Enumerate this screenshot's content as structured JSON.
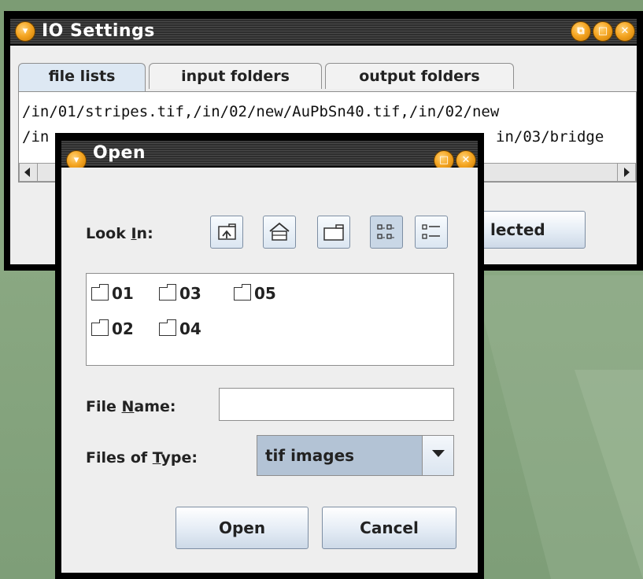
{
  "io_settings": {
    "title": "IO Settings",
    "tabs": [
      {
        "label": "file lists"
      },
      {
        "label": "input folders"
      },
      {
        "label": "output folders"
      }
    ],
    "file_list_lines": [
      "/in/01/stripes.tif,/in/02/new/AuPbSn40.tif,/in/02/new",
      "/in",
      "in/03/bridge"
    ],
    "partial_button_label": "lected"
  },
  "open_dialog": {
    "title": "Open",
    "look_in": {
      "label_pre": "Look ",
      "label_mnemonic": "I",
      "label_post": "n:"
    },
    "toolbar_icons": [
      "up-folder-icon",
      "home-icon",
      "new-folder-icon",
      "list-view-icon",
      "details-view-icon"
    ],
    "folders": [
      "01",
      "03",
      "05",
      "02",
      "04"
    ],
    "file_name": {
      "label_pre": "File ",
      "label_mnemonic": "N",
      "label_post": "ame:",
      "value": ""
    },
    "files_of_type": {
      "label_pre": "Files of ",
      "label_mnemonic": "T",
      "label_post": "ype:",
      "selected": "tif images"
    },
    "open_button": "Open",
    "cancel_button": "Cancel"
  },
  "colors": {
    "accent_orb": "#f5a623",
    "titlebar": "#2e2e2e",
    "background": "#8aa882"
  }
}
